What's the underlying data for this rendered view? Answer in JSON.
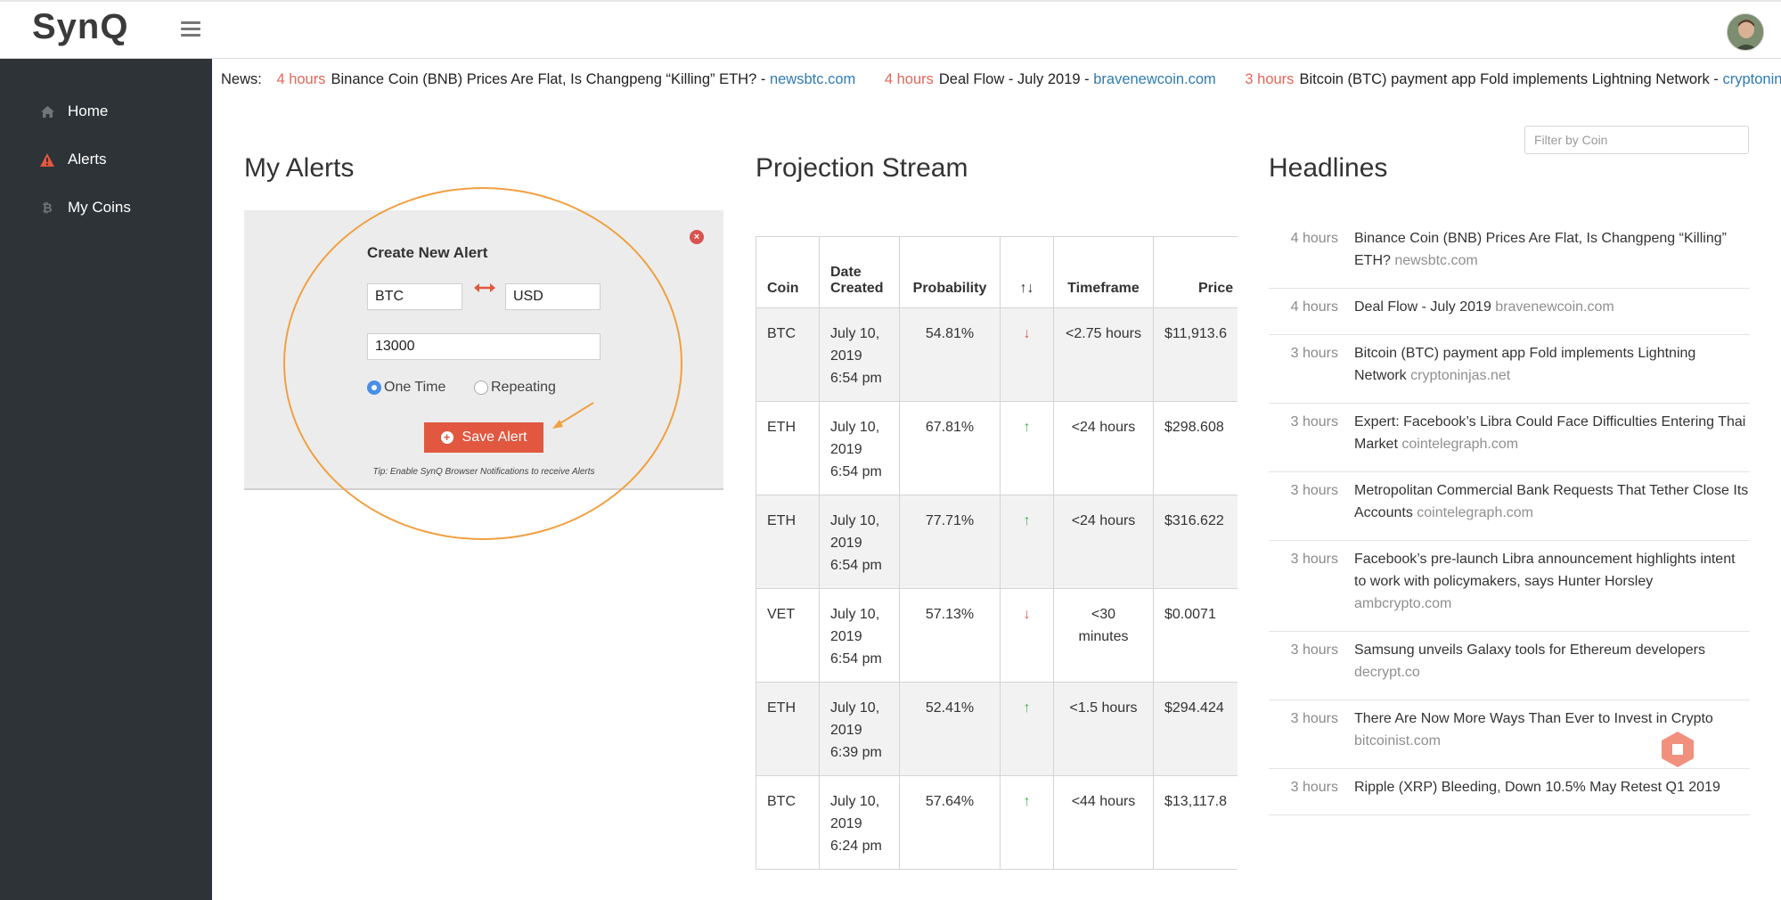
{
  "app": {
    "logo": "SynQ"
  },
  "sidebar": {
    "items": [
      {
        "label": "Home",
        "icon": "home-icon"
      },
      {
        "label": "Alerts",
        "icon": "warning-icon"
      },
      {
        "label": "My Coins",
        "icon": "bitcoin-icon"
      }
    ]
  },
  "news": {
    "label": "News:",
    "items": [
      {
        "time": "4 hours",
        "title": "Binance Coin (BNB) Prices Are Flat, Is Changpeng “Killing” ETH? -",
        "source": "newsbtc.com"
      },
      {
        "time": "4 hours",
        "title": "Deal Flow - July 2019 -",
        "source": "bravenewcoin.com"
      },
      {
        "time": "3 hours",
        "title": "Bitcoin (BTC) payment app Fold implements Lightning Network -",
        "source": "cryptoninjas.net"
      }
    ]
  },
  "filter": {
    "placeholder": "Filter by Coin"
  },
  "alerts": {
    "title": "My Alerts",
    "card_title": "Create New Alert",
    "from_value": "BTC",
    "to_value": "USD",
    "amount_value": "13000",
    "option_one_time": "One Time",
    "option_repeating": "Repeating",
    "selected": "One Time",
    "save_label": "Save Alert",
    "tip": "Tip: Enable SynQ Browser Notifications to receive Alerts",
    "highlight_color": "#f0a040"
  },
  "projection": {
    "title": "Projection Stream",
    "headers": [
      "Coin",
      "Date Created",
      "Probability",
      "↑↓",
      "Timeframe",
      "Price"
    ],
    "rows": [
      {
        "coin": "BTC",
        "date": "July 10, 2019 6:54 pm",
        "probability": "54.81%",
        "direction": "down",
        "timeframe": "<2.75 hours",
        "price": "$11,913.6"
      },
      {
        "coin": "ETH",
        "date": "July 10, 2019 6:54 pm",
        "probability": "67.81%",
        "direction": "up",
        "timeframe": "<24 hours",
        "price": "$298.608"
      },
      {
        "coin": "ETH",
        "date": "July 10, 2019 6:54 pm",
        "probability": "77.71%",
        "direction": "up",
        "timeframe": "<24 hours",
        "price": "$316.622"
      },
      {
        "coin": "VET",
        "date": "July 10, 2019 6:54 pm",
        "probability": "57.13%",
        "direction": "down",
        "timeframe": "<30 minutes",
        "price": "$0.0071"
      },
      {
        "coin": "ETH",
        "date": "July 10, 2019 6:39 pm",
        "probability": "52.41%",
        "direction": "up",
        "timeframe": "<1.5 hours",
        "price": "$294.424"
      },
      {
        "coin": "BTC",
        "date": "July 10, 2019 6:24 pm",
        "probability": "57.64%",
        "direction": "up",
        "timeframe": "<44 hours",
        "price": "$13,117.8"
      }
    ]
  },
  "headlines": {
    "title": "Headlines",
    "items": [
      {
        "time": "4 hours",
        "title": "Binance Coin (BNB) Prices Are Flat, Is Changpeng “Killing” ETH?",
        "source": "newsbtc.com"
      },
      {
        "time": "4 hours",
        "title": "Deal Flow - July 2019",
        "source": "bravenewcoin.com"
      },
      {
        "time": "3 hours",
        "title": "Bitcoin (BTC) payment app Fold implements Lightning Network",
        "source": "cryptoninjas.net"
      },
      {
        "time": "3 hours",
        "title": "Expert: Facebook’s Libra Could Face Difficulties Entering Thai Market",
        "source": "cointelegraph.com"
      },
      {
        "time": "3 hours",
        "title": "Metropolitan Commercial Bank Requests That Tether Close Its Accounts",
        "source": "cointelegraph.com"
      },
      {
        "time": "3 hours",
        "title": "Facebook’s pre-launch Libra announcement highlights intent to work with policymakers, says Hunter Horsley",
        "source": "ambcrypto.com"
      },
      {
        "time": "3 hours",
        "title": "Samsung unveils Galaxy tools for Ethereum developers",
        "source": "decrypt.co"
      },
      {
        "time": "3 hours",
        "title": "There Are Now More Ways Than Ever to Invest in Crypto",
        "source": "bitcoinist.com"
      },
      {
        "time": "3 hours",
        "title": "Ripple (XRP) Bleeding, Down 10.5% May Retest Q1 2019",
        "source": ""
      }
    ]
  },
  "colors": {
    "sidebar_bg": "#2d3337",
    "accent": "#e1573f",
    "link": "#2f7bb6",
    "up": "#4caf50",
    "down": "#e05a4f"
  }
}
